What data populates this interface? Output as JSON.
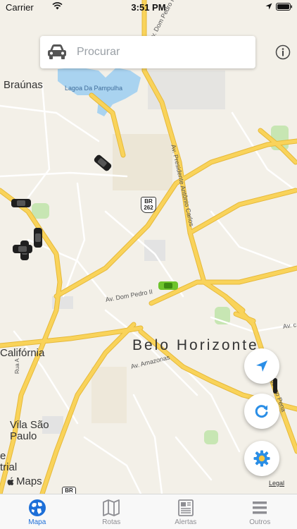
{
  "status_bar": {
    "carrier": "Carrier",
    "time": "3:51 PM"
  },
  "search": {
    "placeholder": "Procurar"
  },
  "map": {
    "labels": {
      "braunas": "Braúnas",
      "lagoa": "Lagoa Da Pampulha",
      "av_presidente": "Av. Presidente Antônio Carlos",
      "br262": "BR 262",
      "av_dom_pedro": "Av. Dom Pedro II",
      "av_dom_pedro_top": "Av. Dom Pedro I",
      "belo_horizonte": "Belo Horizonte",
      "av_amazonas": "Av. Amazonas",
      "california": "Califórnia",
      "vila_sao_paulo_1": "Vila São",
      "vila_sao_paulo_2": "Paulo",
      "rua_a": "Rua A",
      "av_c": "Av. c",
      "afonso_pena": "Afonso Pena",
      "estrial_1": "e",
      "estrial_2": "trial",
      "br_bottom": "BR"
    },
    "brand": "Maps",
    "legal": "Legal",
    "colors": {
      "background": "#f3f0e8",
      "water": "#a9d3f0",
      "road_major": "#f9d35a",
      "road_minor": "#ffffff",
      "park": "#c7e6b3",
      "active_car": "#6ec42d"
    }
  },
  "tabs": [
    {
      "label": "Mapa",
      "icon": "globe-icon",
      "active": true
    },
    {
      "label": "Rotas",
      "icon": "map-icon",
      "active": false
    },
    {
      "label": "Alertas",
      "icon": "newspaper-icon",
      "active": false
    },
    {
      "label": "Outros",
      "icon": "menu-icon",
      "active": false
    }
  ]
}
